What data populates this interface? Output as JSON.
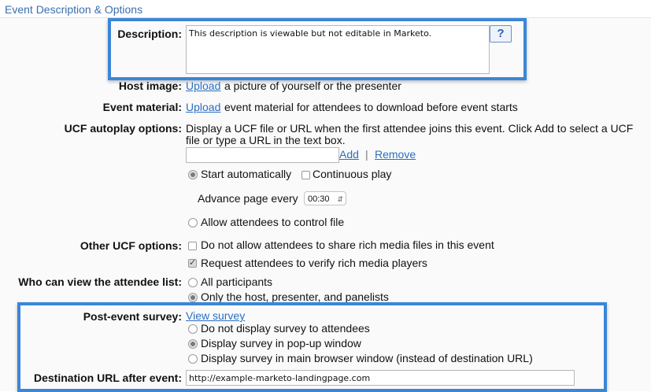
{
  "section": {
    "title": "Event Description & Options"
  },
  "description": {
    "label": "Description:",
    "value": "This description is viewable but not editable in Marketo.",
    "help_label": "?"
  },
  "host_image": {
    "label": "Host image:",
    "link": "Upload",
    "text": "a picture of yourself or the presenter"
  },
  "event_material": {
    "label": "Event material:",
    "link": "Upload",
    "text": "event material for attendees to download before event starts"
  },
  "ucf_autoplay": {
    "label": "UCF autoplay options:",
    "text_line1": "Display a UCF file or URL when the first attendee joins this event. Click Add to select a UCF",
    "text_line2": "file or type a URL in the text box.",
    "add": "Add",
    "separator": "|",
    "remove": "Remove",
    "start_auto": "Start automatically",
    "continuous": "Continuous play",
    "advance_label": "Advance page every",
    "advance_value": "00:30",
    "allow_control": "Allow attendees to control file"
  },
  "other_ucf": {
    "label": "Other UCF options:",
    "no_share": "Do not allow attendees to share rich media files in this event",
    "verify": "Request attendees to verify rich media players"
  },
  "attendee_list": {
    "label": "Who can view the attendee list:",
    "all": "All participants",
    "only_host": "Only the host, presenter, and panelists"
  },
  "survey": {
    "label": "Post-event survey:",
    "link": "View survey",
    "opt1": "Do not display survey to attendees",
    "opt2": "Display survey in pop-up window",
    "opt3": "Display survey in main browser window (instead of destination URL)"
  },
  "destination": {
    "label": "Destination URL after event:",
    "value": "http://example-marketo-landingpage.com"
  },
  "colors": {
    "section_title": "#3a6fb0",
    "link": "#2a6fc0",
    "highlight_border": "#3b86d8"
  }
}
